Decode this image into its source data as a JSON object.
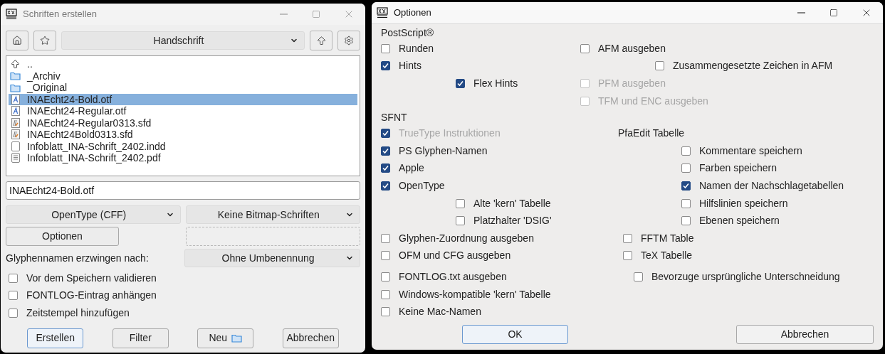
{
  "left_window": {
    "title": "Schriften erstellen",
    "toolbar": {
      "path": "Handschrift"
    },
    "files": [
      {
        "name": "..",
        "kind": "parent",
        "selected": false
      },
      {
        "name": "_Archiv",
        "kind": "folder",
        "selected": false
      },
      {
        "name": "_Original",
        "kind": "folder",
        "selected": false
      },
      {
        "name": "INAEcht24-Bold.otf",
        "kind": "font",
        "selected": true
      },
      {
        "name": "INAEcht24-Regular.otf",
        "kind": "font",
        "selected": false
      },
      {
        "name": "INAEcht24-Regular0313.sfd",
        "kind": "sfd",
        "selected": false
      },
      {
        "name": "INAEcht24Bold0313.sfd",
        "kind": "sfd",
        "selected": false
      },
      {
        "name": "Infoblatt_INA-Schrift_2402.indd",
        "kind": "blank",
        "selected": false
      },
      {
        "name": "Infoblatt_INA-Schrift_2402.pdf",
        "kind": "doc",
        "selected": false
      }
    ],
    "filename": "INAEcht24-Bold.otf",
    "outline_format": "OpenType (CFF)",
    "bitmap_format": "Keine Bitmap-Schriften",
    "options_button": "Optionen",
    "glyph_names_label": "Glyphennamen erzwingen nach:",
    "glyph_names_value": "Ohne Umbenennung",
    "checkboxes": [
      {
        "label": "Vor dem Speichern validieren",
        "checked": false
      },
      {
        "label": "FONTLOG-Eintrag anhängen",
        "checked": false
      },
      {
        "label": "Zeitstempel hinzufügen",
        "checked": false
      }
    ],
    "buttons": [
      {
        "label": "Erstellen",
        "default": true,
        "folder_icon": false
      },
      {
        "label": "Filter",
        "default": false,
        "folder_icon": false
      },
      {
        "label": "Neu",
        "default": false,
        "folder_icon": true
      },
      {
        "label": "Abbrechen",
        "default": false,
        "folder_icon": false
      }
    ]
  },
  "options_window": {
    "title": "Optionen",
    "postscript": {
      "heading": "PostScript®",
      "left": [
        {
          "label": "Runden",
          "checked": false,
          "disabled": false
        },
        {
          "label": "Hints",
          "checked": true,
          "disabled": false,
          "children": [
            {
              "label": "Flex Hints",
              "checked": true,
              "disabled": false
            }
          ]
        }
      ],
      "right": [
        {
          "label": "AFM ausgeben",
          "checked": false,
          "disabled": false,
          "children": [
            {
              "label": "Zusammengesetzte Zeichen in AFM",
              "checked": false,
              "disabled": false
            }
          ]
        },
        {
          "label": "PFM ausgeben",
          "checked": false,
          "disabled": true
        },
        {
          "label": "TFM und ENC ausgeben",
          "checked": false,
          "disabled": true
        }
      ]
    },
    "sfnt": {
      "heading": "SFNT",
      "left": [
        {
          "label": "TrueType Instruktionen",
          "checked": true,
          "disabled": true
        },
        {
          "label": "PS Glyphen-Namen",
          "checked": true,
          "disabled": false
        },
        {
          "label": "Apple",
          "checked": true,
          "disabled": false
        },
        {
          "label": "OpenType",
          "checked": true,
          "disabled": false,
          "children": [
            {
              "label": "Alte 'kern' Tabelle",
              "checked": false,
              "disabled": false
            },
            {
              "label": "Platzhalter 'DSIG'",
              "checked": false,
              "disabled": false
            }
          ]
        },
        {
          "label": "Glyphen-Zuordnung ausgeben",
          "checked": false,
          "disabled": false
        },
        {
          "label": "OFM und CFG ausgeben",
          "checked": false,
          "disabled": false
        }
      ],
      "pfaedit": {
        "heading": "PfaEdit Tabelle",
        "items": [
          {
            "label": "Kommentare speichern",
            "checked": false,
            "disabled": false
          },
          {
            "label": "Farben speichern",
            "checked": false,
            "disabled": false
          },
          {
            "label": "Namen der Nachschlagetabellen",
            "checked": true,
            "disabled": false
          },
          {
            "label": "Hilfslinien speichern",
            "checked": false,
            "disabled": false
          },
          {
            "label": "Ebenen speichern",
            "checked": false,
            "disabled": false
          }
        ]
      },
      "right": [
        {
          "label": "FFTM Table",
          "checked": false,
          "disabled": false
        },
        {
          "label": "TeX Tabelle",
          "checked": false,
          "disabled": false
        }
      ]
    },
    "misc": {
      "left": [
        {
          "label": "FONTLOG.txt ausgeben",
          "checked": false,
          "disabled": false
        },
        {
          "label": "Windows-kompatible 'kern' Tabelle",
          "checked": false,
          "disabled": false
        },
        {
          "label": "Keine Mac-Namen",
          "checked": false,
          "disabled": false
        }
      ],
      "right": [
        {
          "label": "Bevorzuge ursprüngliche Unterschneidung",
          "checked": false,
          "disabled": false
        }
      ]
    },
    "buttons": [
      {
        "label": "OK",
        "default": true
      },
      {
        "label": "Abbrechen",
        "default": false
      }
    ]
  }
}
